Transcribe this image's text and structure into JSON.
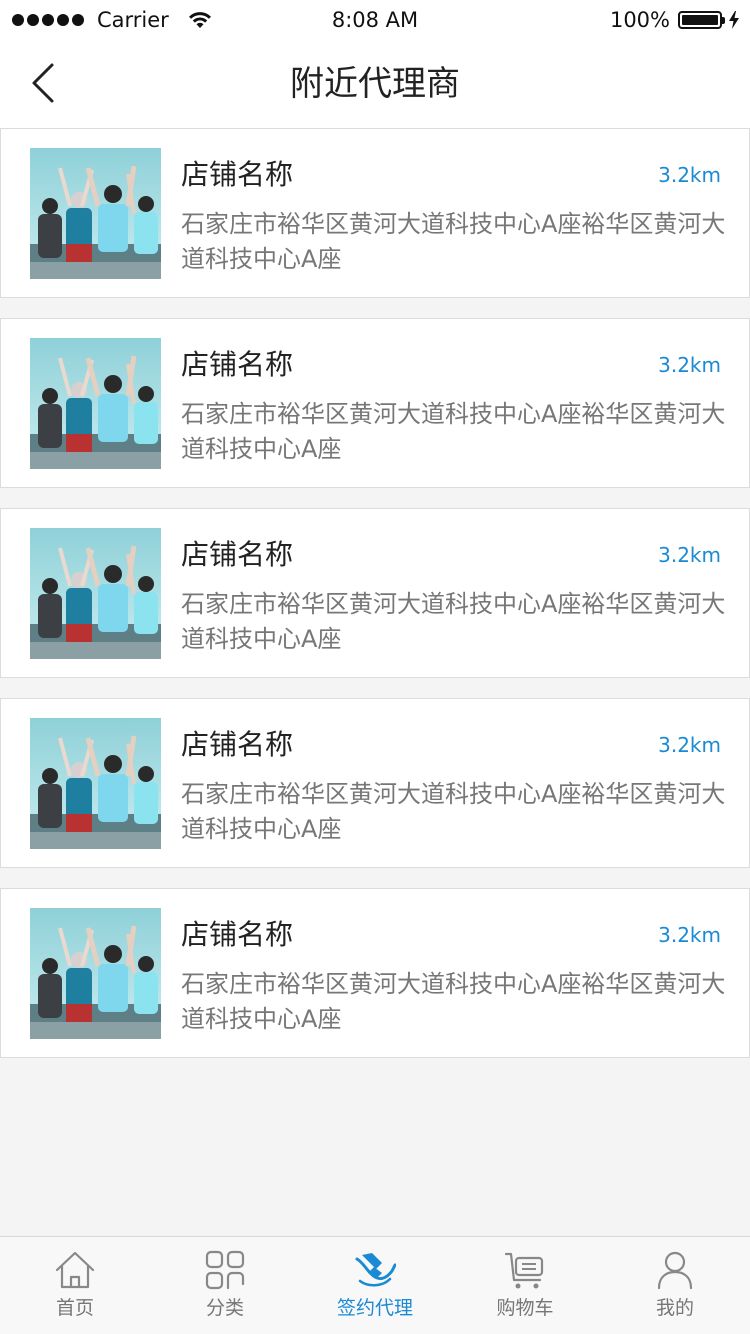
{
  "status_bar": {
    "carrier": "Carrier",
    "time": "8:08 AM",
    "battery": "100%"
  },
  "nav": {
    "title": "附近代理商",
    "back_icon": "chevron-left-icon"
  },
  "stores": [
    {
      "name": "店铺名称",
      "distance": "3.2km",
      "address": "石家庄市裕华区黄河大道科技中心A座裕华区黄河大道科技中心A座"
    },
    {
      "name": "店铺名称",
      "distance": "3.2km",
      "address": "石家庄市裕华区黄河大道科技中心A座裕华区黄河大道科技中心A座"
    },
    {
      "name": "店铺名称",
      "distance": "3.2km",
      "address": "石家庄市裕华区黄河大道科技中心A座裕华区黄河大道科技中心A座"
    },
    {
      "name": "店铺名称",
      "distance": "3.2km",
      "address": "石家庄市裕华区黄河大道科技中心A座裕华区黄河大道科技中心A座"
    },
    {
      "name": "店铺名称",
      "distance": "3.2km",
      "address": "石家庄市裕华区黄河大道科技中心A座裕华区黄河大道科技中心A座"
    }
  ],
  "tabs": [
    {
      "label": "首页",
      "icon": "home-icon",
      "active": false
    },
    {
      "label": "分类",
      "icon": "grid-icon",
      "active": false
    },
    {
      "label": "签约代理",
      "icon": "handshake-icon",
      "active": true
    },
    {
      "label": "购物车",
      "icon": "cart-icon",
      "active": false
    },
    {
      "label": "我的",
      "icon": "user-icon",
      "active": false
    }
  ],
  "colors": {
    "accent": "#1a8ad4",
    "background": "#f4f4f4"
  }
}
